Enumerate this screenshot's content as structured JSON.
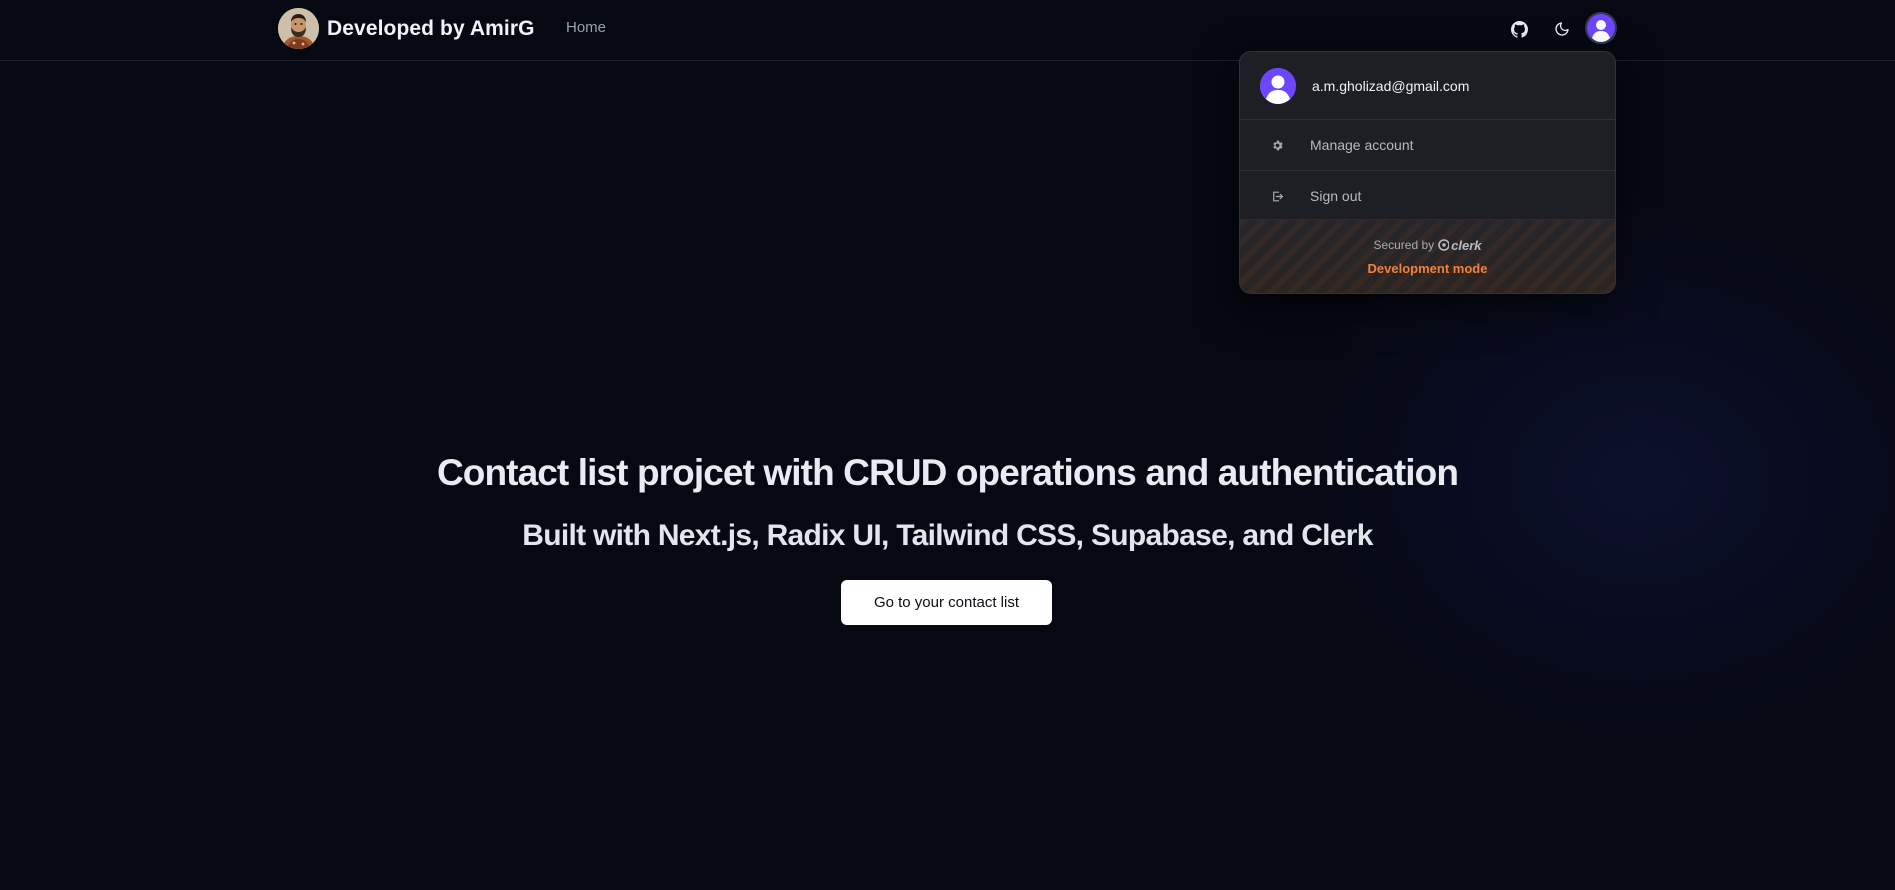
{
  "header": {
    "brand_title": "Developed by AmirG",
    "nav": [
      {
        "label": "Home"
      }
    ],
    "icons": [
      "github-icon",
      "moon-icon",
      "user-avatar-icon"
    ]
  },
  "user_menu": {
    "email": "a.m.gholizad@gmail.com",
    "items": [
      {
        "label": "Manage account",
        "icon": "gear-icon"
      },
      {
        "label": "Sign out",
        "icon": "sign-out-icon"
      }
    ],
    "secured_by": "Secured by",
    "provider": "clerk",
    "mode": "Development mode"
  },
  "hero": {
    "title": "Contact list projcet with CRUD operations and authentication",
    "subtitle": "Built with Next.js, Radix UI, Tailwind CSS, Supabase, and Clerk",
    "cta_label": "Go to your contact list"
  },
  "colors": {
    "background": "#060812",
    "clerk_purple": "#6c47ff",
    "dev_mode_orange": "#f3813b",
    "cta_background": "#ffffff"
  }
}
